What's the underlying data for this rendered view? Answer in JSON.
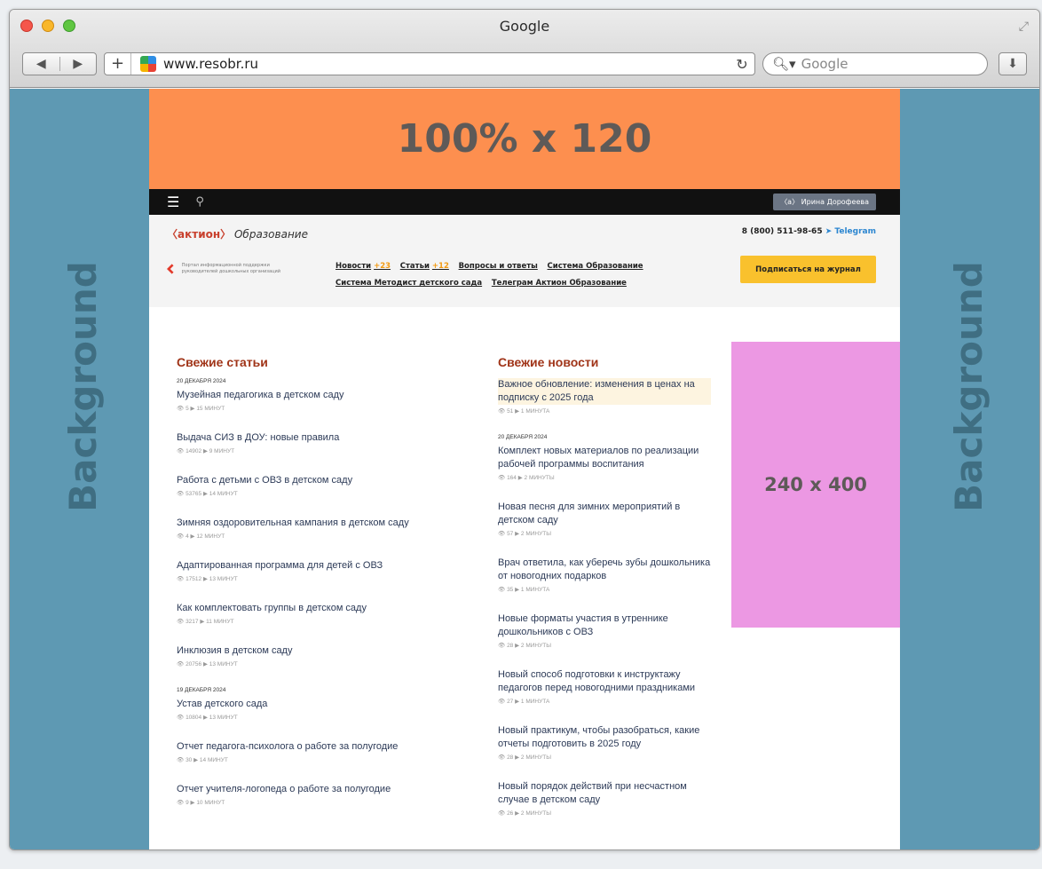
{
  "window": {
    "title": "Google"
  },
  "toolbar": {
    "url": "www.resobr.ru",
    "search_placeholder": "Google",
    "back": "◀",
    "forward": "▶",
    "plus": "+",
    "reload": "↻",
    "download": "⬇"
  },
  "background": {
    "left": "Background",
    "right": "Background",
    "color": "#5e99b3"
  },
  "banner": {
    "text": "100% x 120",
    "color": "#fd8f4f"
  },
  "topbar": {
    "user": "〈а〉 Ирина Дорофеева"
  },
  "header": {
    "logo_brand": "〈актион〉",
    "logo_sub": "Образование",
    "phone": "8 (800) 511-98-65",
    "telegram": "Telegram",
    "portal_text": "Портал информационной поддержки руководителей дошкольных организаций",
    "subscribe": "Подписаться на журнал"
  },
  "menu": [
    {
      "label": "Новости",
      "badge": "+23"
    },
    {
      "label": "Статьи",
      "badge": "+12"
    },
    {
      "label": "Вопросы и ответы",
      "badge": ""
    },
    {
      "label": "Система Образование",
      "badge": ""
    },
    {
      "label": "Система Методист детского сада",
      "badge": ""
    },
    {
      "label": "Телеграм Актион Образование",
      "badge": ""
    }
  ],
  "articles": {
    "title": "Свежие статьи",
    "items": [
      {
        "date": "20 ДЕКАБРЯ 2024",
        "title": "Музейная педагогика в детском саду",
        "views": "5",
        "time": "15 МИНУТ"
      },
      {
        "date": "",
        "title": "Выдача СИЗ в ДОУ: новые правила",
        "views": "14902",
        "time": "9 МИНУТ"
      },
      {
        "date": "",
        "title": "Работа с детьми с ОВЗ в детском саду",
        "views": "53765",
        "time": "14 МИНУТ"
      },
      {
        "date": "",
        "title": "Зимняя оздоровительная кампания в детском саду",
        "views": "4",
        "time": "12 МИНУТ"
      },
      {
        "date": "",
        "title": "Адаптированная программа для детей с ОВЗ",
        "views": "17512",
        "time": "13 МИНУТ"
      },
      {
        "date": "",
        "title": "Как комплектовать группы в детском саду",
        "views": "3217",
        "time": "11 МИНУТ"
      },
      {
        "date": "",
        "title": "Инклюзия в детском саду",
        "views": "20756",
        "time": "13 МИНУТ"
      },
      {
        "date": "19 ДЕКАБРЯ 2024",
        "title": "Устав детского сада",
        "views": "10804",
        "time": "13 МИНУТ"
      },
      {
        "date": "",
        "title": "Отчет педагога-психолога о работе за полугодие",
        "views": "30",
        "time": "14 МИНУТ"
      },
      {
        "date": "",
        "title": "Отчет учителя-логопеда о работе за полугодие",
        "views": "9",
        "time": "10 МИНУТ"
      }
    ]
  },
  "news": {
    "title": "Свежие новости",
    "items": [
      {
        "date": "",
        "title": "Важное обновление: изменения в ценах на подписку с 2025 года",
        "views": "51",
        "time": "1 МИНУТА"
      },
      {
        "date": "20 ДЕКАБРЯ 2024",
        "title": "Комплект новых материалов по реализации рабочей программы воспитания",
        "views": "164",
        "time": "2 МИНУТЫ"
      },
      {
        "date": "",
        "title": "Новая песня для зимних мероприятий в детском саду",
        "views": "57",
        "time": "2 МИНУТЫ"
      },
      {
        "date": "",
        "title": "Врач ответила, как уберечь зубы дошкольника от новогодних подарков",
        "views": "35",
        "time": "1 МИНУТА"
      },
      {
        "date": "",
        "title": "Новые форматы участия в утреннике дошкольников с ОВЗ",
        "views": "28",
        "time": "2 МИНУТЫ"
      },
      {
        "date": "",
        "title": "Новый способ подготовки к инструктажу педагогов перед новогодними праздниками",
        "views": "27",
        "time": "1 МИНУТА"
      },
      {
        "date": "",
        "title": "Новый практикум, чтобы разобраться, какие отчеты подготовить в 2025 году",
        "views": "28",
        "time": "2 МИНУТЫ"
      },
      {
        "date": "",
        "title": "Новый порядок действий при несчастном случае в детском саду",
        "views": "26",
        "time": "2 МИНУТЫ"
      }
    ]
  },
  "ad": {
    "text": "240 x 400",
    "color": "#ec98e3"
  }
}
